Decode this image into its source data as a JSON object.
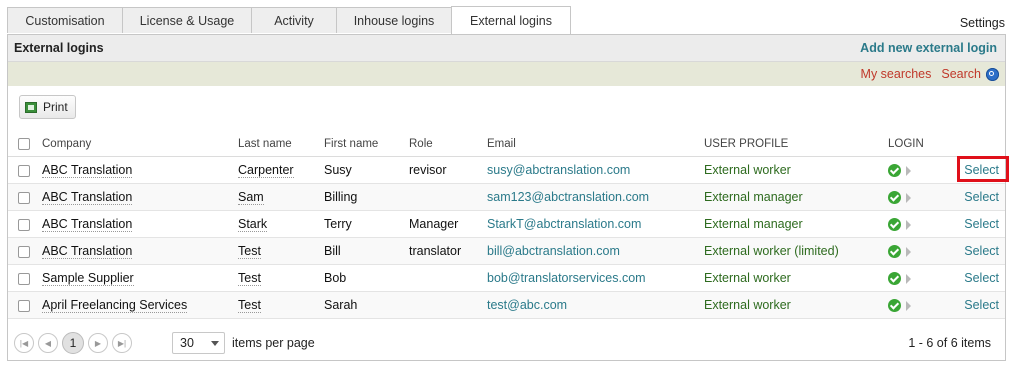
{
  "tabs": [
    {
      "label": "Customisation"
    },
    {
      "label": "License & Usage"
    },
    {
      "label": "Activity"
    },
    {
      "label": "Inhouse logins"
    },
    {
      "label": "External logins"
    }
  ],
  "settings_label": "Settings",
  "panel": {
    "title": "External logins",
    "add_link": "Add new external login",
    "my_searches": "My searches",
    "search": "Search"
  },
  "toolbar": {
    "print_label": "Print"
  },
  "columns": {
    "company": "Company",
    "last_name": "Last name",
    "first_name": "First name",
    "role": "Role",
    "email": "Email",
    "profile": "USER PROFILE",
    "login": "LOGIN"
  },
  "rows": [
    {
      "company": "ABC Translation",
      "last": "Carpenter",
      "first": "Susy",
      "role": "revisor",
      "email": "susy@abctranslation.com",
      "profile": "External worker",
      "action": "Select"
    },
    {
      "company": "ABC Translation",
      "last": "Sam",
      "first": "Billing",
      "role": "",
      "email": "sam123@abctranslation.com",
      "profile": "External manager",
      "action": "Select"
    },
    {
      "company": "ABC Translation",
      "last": "Stark",
      "first": "Terry",
      "role": "Manager",
      "email": "StarkT@abctranslation.com",
      "profile": "External manager",
      "action": "Select"
    },
    {
      "company": "ABC Translation",
      "last": "Test",
      "first": "Bill",
      "role": "translator",
      "email": "bill@abctranslation.com",
      "profile": "External worker (limited)",
      "action": "Select"
    },
    {
      "company": "Sample Supplier",
      "last": "Test",
      "first": "Bob",
      "role": "",
      "email": "bob@translatorservices.com",
      "profile": "External worker",
      "action": "Select"
    },
    {
      "company": "April Freelancing Services",
      "last": "Test",
      "first": "Sarah",
      "role": "",
      "email": "test@abc.com",
      "profile": "External worker",
      "action": "Select"
    }
  ],
  "pager": {
    "current_page": "1",
    "per_page": "30",
    "per_page_label": "items per page",
    "count": "1 - 6 of 6 items"
  },
  "colors": {
    "accent": "#2b7a8a",
    "highlight": "#e0101a",
    "ok": "#3aa635"
  }
}
